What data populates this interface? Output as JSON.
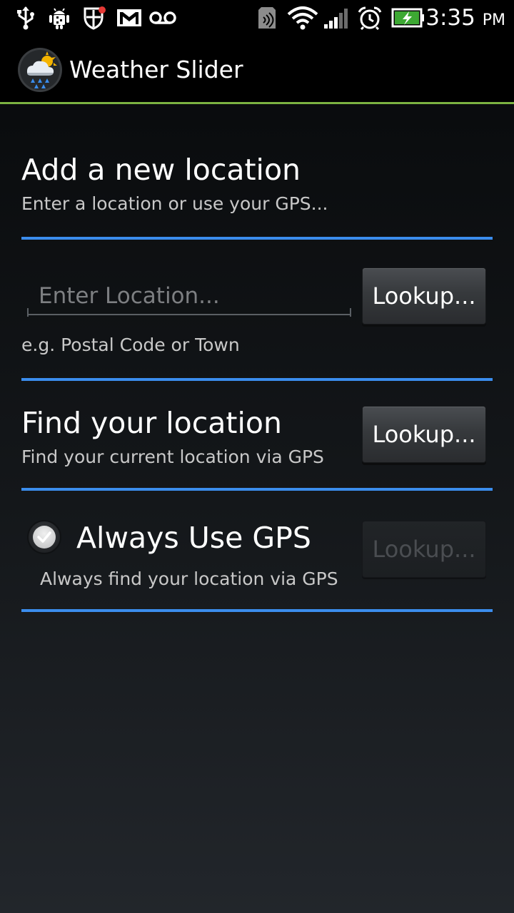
{
  "status_bar": {
    "time": "3:35",
    "ampm": "PM",
    "icons_left": [
      "usb-icon",
      "android-debug-icon",
      "shield-icon",
      "gmail-icon",
      "voicemail-icon"
    ],
    "icons_right": [
      "nfc-icon",
      "wifi-icon",
      "signal-icon",
      "alarm-icon",
      "battery-charging-icon"
    ]
  },
  "action_bar": {
    "title": "Weather Slider",
    "accent_color": "#7cb342"
  },
  "add_location": {
    "title": "Add a new location",
    "subtitle": "Enter a location or use your GPS...",
    "input_placeholder": "Enter Location...",
    "input_value": "",
    "hint": "e.g. Postal Code or Town",
    "lookup_label": "Lookup..."
  },
  "find_location": {
    "title": "Find your location",
    "subtitle": "Find your current location via GPS",
    "lookup_label": "Lookup..."
  },
  "always_gps": {
    "title": "Always Use GPS",
    "subtitle": "Always find your location via GPS",
    "checked": true,
    "lookup_label": "Lookup...",
    "lookup_enabled": false
  },
  "colors": {
    "divider_blue": "#3b8ded",
    "background_top": "#050607",
    "background_bottom": "#22262b"
  }
}
